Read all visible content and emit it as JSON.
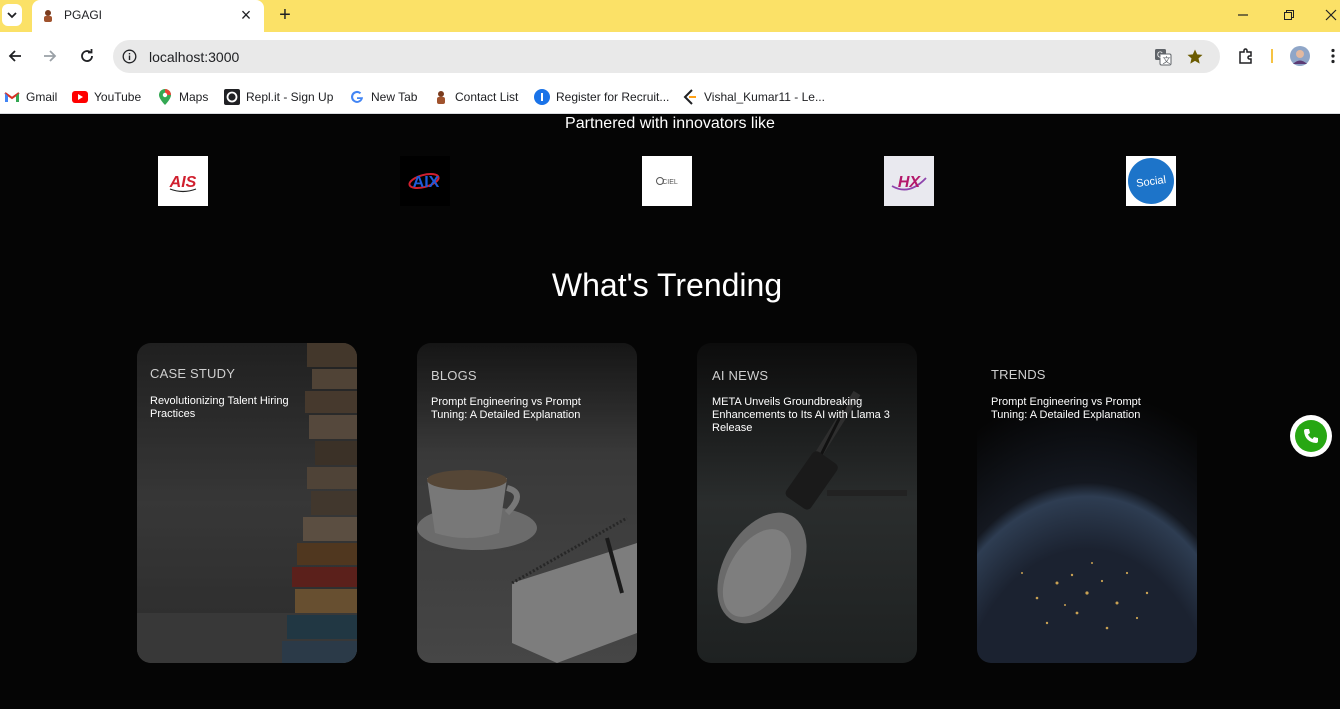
{
  "browser": {
    "tab_title": "PGAGI",
    "url": "localhost:3000",
    "bookmarks": [
      {
        "label": "Gmail",
        "icon": "gmail-icon"
      },
      {
        "label": "YouTube",
        "icon": "youtube-icon"
      },
      {
        "label": "Maps",
        "icon": "maps-icon"
      },
      {
        "label": "Repl.it - Sign Up",
        "icon": "replit-icon"
      },
      {
        "label": "New Tab",
        "icon": "google-icon"
      },
      {
        "label": "Contact List",
        "icon": "contact-list-icon"
      },
      {
        "label": "Register for Recruit...",
        "icon": "register-icon"
      },
      {
        "label": "Vishal_Kumar11 - Le...",
        "icon": "leetcode-icon"
      }
    ]
  },
  "partners": {
    "heading": "Partnered with innovators like",
    "logos": [
      {
        "name": "AIS",
        "text": "AIS"
      },
      {
        "name": "AIX",
        "text": "AIX"
      },
      {
        "name": "CIEL",
        "text": "CIEL"
      },
      {
        "name": "HX",
        "text": "HX"
      },
      {
        "name": "Social",
        "text": "Social"
      }
    ]
  },
  "trending": {
    "title": "What's Trending",
    "cards": [
      {
        "category": "CASE STUDY",
        "text": "Revolutionizing Talent Hiring Practices"
      },
      {
        "category": "BLOGS",
        "text": "Prompt Engineering vs Prompt Tuning: A Detailed Explanation"
      },
      {
        "category": "AI NEWS",
        "text": "META Unveils Groundbreaking Enhancements to Its AI with Llama 3 Release"
      },
      {
        "category": "TRENDS",
        "text": "Prompt Engineering vs Prompt Tuning: A Detailed Explanation"
      }
    ]
  },
  "colors": {
    "tabbar": "#fbe167",
    "page_bg": "#050505",
    "call_green": "#27a713"
  }
}
